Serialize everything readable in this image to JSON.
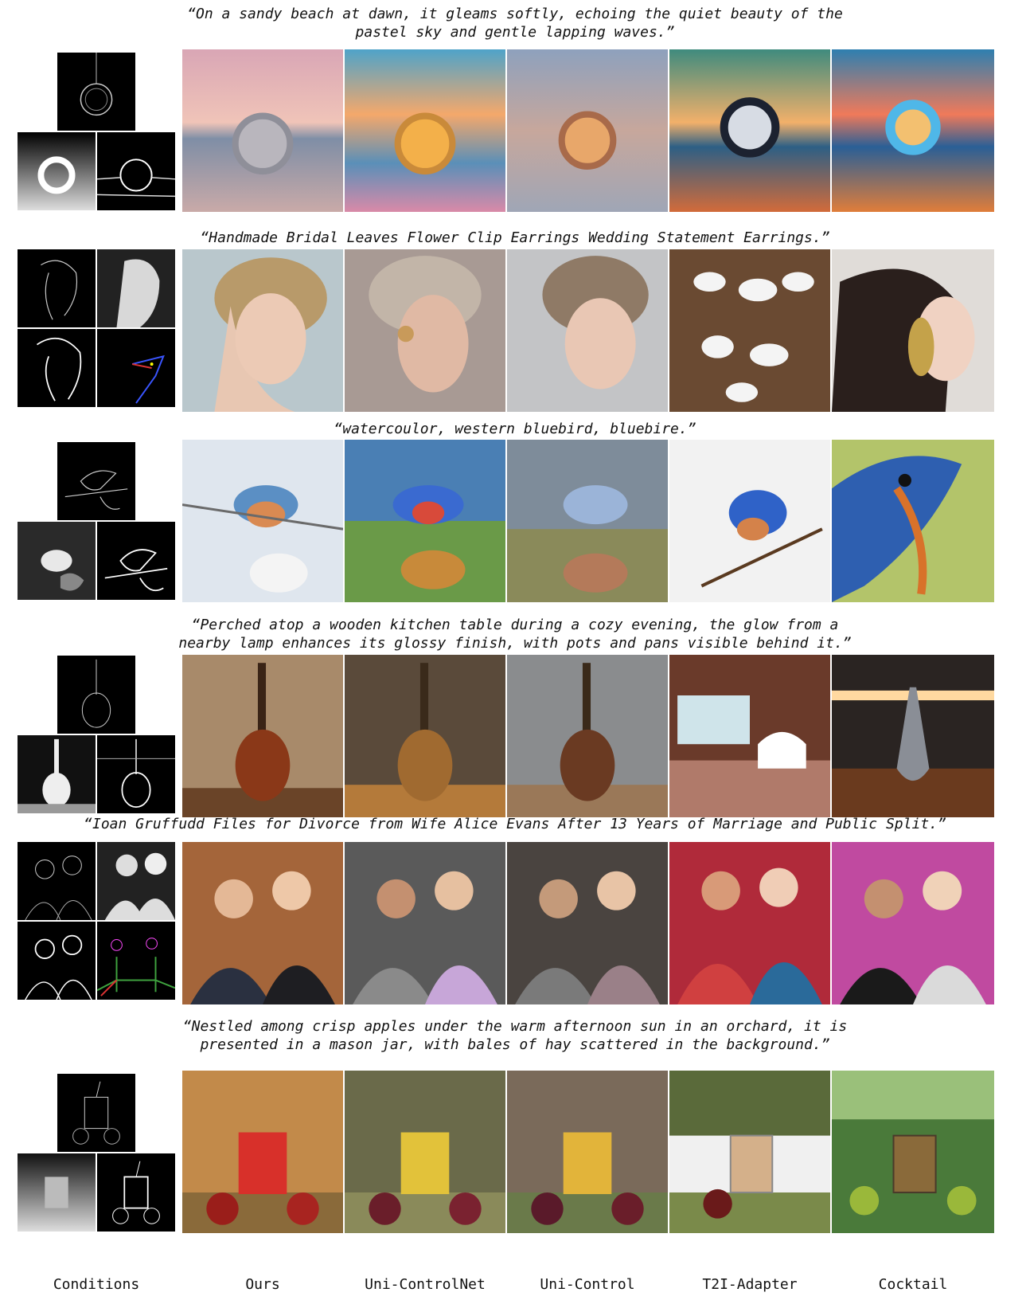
{
  "captions": [
    "“On a sandy beach at dawn, it gleams softly, echoing the quiet beauty of the\npastel sky and gentle lapping waves.”",
    "“Handmade Bridal Leaves Flower Clip Earrings Wedding Statement Earrings.”",
    "“watercoulor, western bluebird, bluebire.”",
    "“Perched atop a wooden kitchen table during a cozy evening, the glow from a\nnearby lamp enhances its glossy finish, with pots and pans visible behind it.”",
    "“Ioan Gruffudd Files for Divorce from Wife Alice Evans After 13 Years of Marriage and Public Split.”",
    "“Nestled among crisp apples under the warm afternoon sun in an orchard, it is\npresented in a mason jar, with bales of hay scattered in the background.”"
  ],
  "column_labels": [
    "Conditions",
    "Ours",
    "Uni-ControlNet",
    "Uni-Control",
    "T2I-Adapter",
    "Cocktail"
  ]
}
